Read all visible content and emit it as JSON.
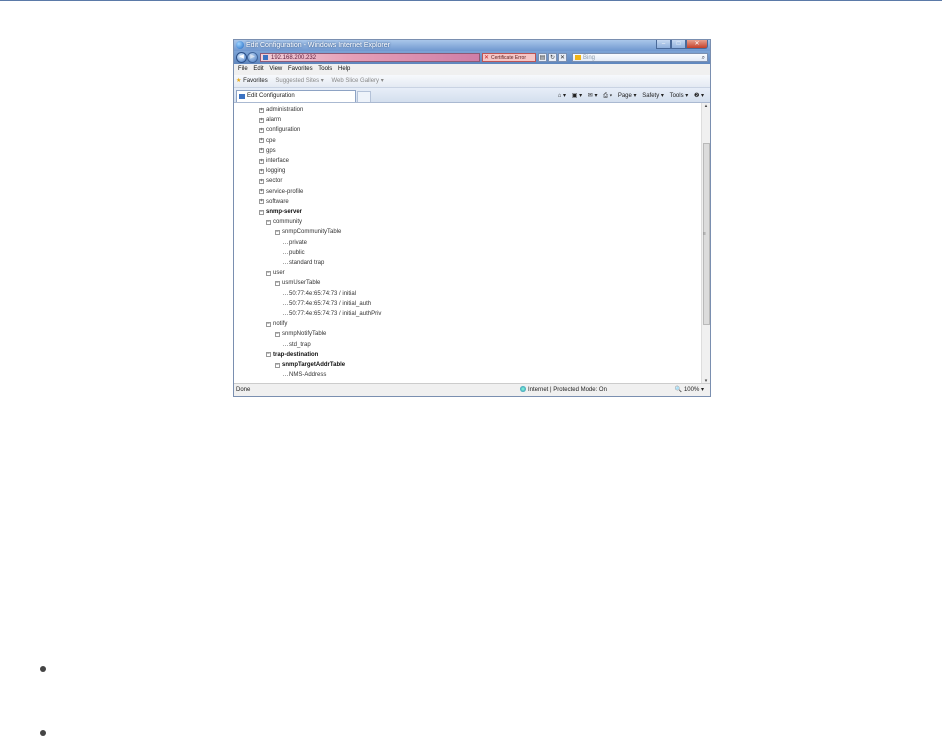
{
  "window": {
    "title": "Edit Configuration - Windows Internet Explorer",
    "url": "192.168.200.232",
    "certificate": "Certificate Error",
    "search_placeholder": "Bing",
    "min_glyph": "–",
    "max_glyph": "□",
    "close_glyph": "✕"
  },
  "menu": [
    "File",
    "Edit",
    "View",
    "Favorites",
    "Tools",
    "Help"
  ],
  "favorites": {
    "label": "Favorites",
    "suggested": "Suggested Sites ▾",
    "slice": "Web Slice Gallery ▾"
  },
  "tab": {
    "label": "Edit Configuration"
  },
  "command_bar": [
    "Page ▾",
    "Safety ▾",
    "Tools ▾",
    "❷ ▾"
  ],
  "tree": {
    "collapsed": [
      "administration",
      "alarm",
      "configuration",
      "cpe",
      "gps",
      "interface",
      "logging",
      "sector",
      "service-profile",
      "software"
    ],
    "snmp_server": "snmp-server",
    "community": "community",
    "community_table": "snmpCommunityTable",
    "community_entries": [
      "private",
      "public",
      "standard trap"
    ],
    "user": "user",
    "user_table": "usmUserTable",
    "user_entries": [
      "50:77:4e:65:74:73 / initial",
      "50:77:4e:65:74:73 / initial_auth",
      "50:77:4e:65:74:73 / initial_authPriv"
    ],
    "notify": "notify",
    "notify_table": "snmpNotifyTable",
    "notify_entries": [
      "std_trap"
    ],
    "trap_destination": "trap-destination",
    "target_table": "snmpTargetAddrTable",
    "target_entries": [
      "NMS-Address"
    ]
  },
  "status": {
    "done": "Done",
    "zone": "Internet | Protected Mode: On",
    "zoom": "🔍 100% ▾"
  },
  "scrollbar": {
    "grip": "≡",
    "up": "▴",
    "down": "▾"
  }
}
